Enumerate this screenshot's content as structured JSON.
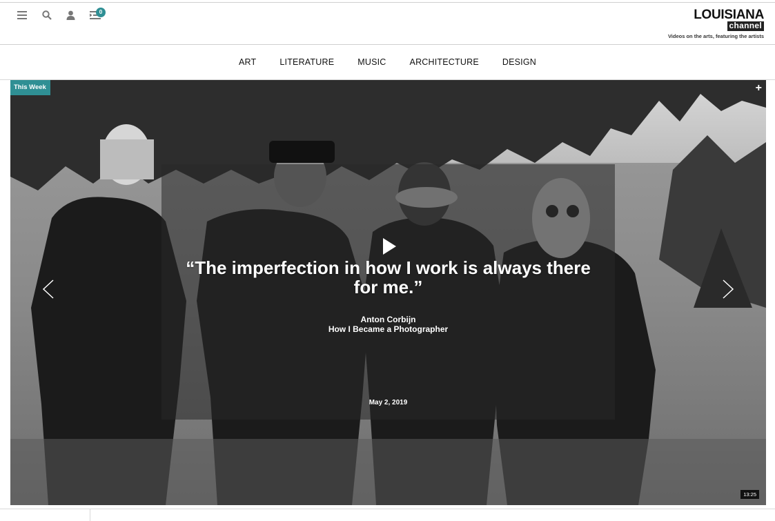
{
  "header": {
    "notification_count": "0",
    "logo_top": "LOUISIANA",
    "logo_bottom": "channel",
    "tagline": "Videos on the arts, featuring the artists"
  },
  "nav": {
    "items": [
      "ART",
      "LITERATURE",
      "MUSIC",
      "ARCHITECTURE",
      "DESIGN"
    ]
  },
  "hero": {
    "tag": "This Week",
    "plus": "+",
    "quote": "“The imperfection in how I work is always there for me.”",
    "author": "Anton Corbijn",
    "video_title": "How I Became a Photographer",
    "date": "May 2, 2019",
    "duration": "13:25"
  },
  "colors": {
    "accent": "#2f8f94",
    "text": "#111111",
    "overlay": "#282828"
  },
  "icons": [
    "menu-icon",
    "search-icon",
    "user-icon",
    "playlist-icon",
    "play-icon",
    "chevron-left-icon",
    "chevron-right-icon"
  ]
}
